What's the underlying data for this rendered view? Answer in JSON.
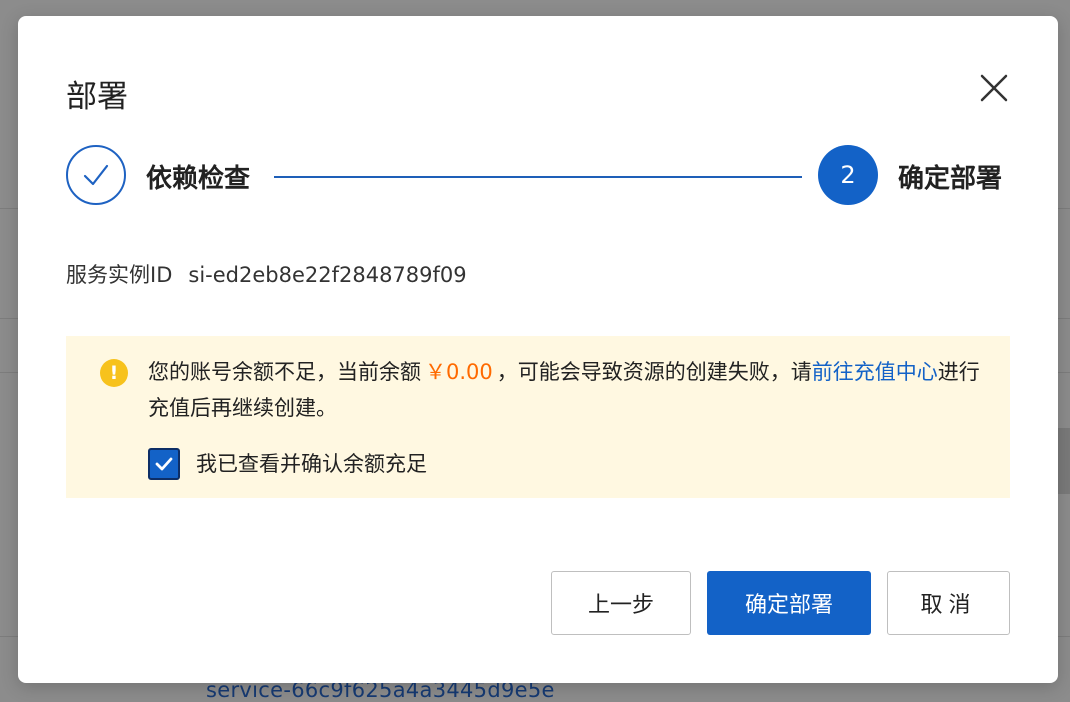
{
  "dialog": {
    "title": "部署",
    "close_icon": "close-icon"
  },
  "steps": [
    {
      "label": "依赖检查",
      "status": "done",
      "icon": "checkmark-icon"
    },
    {
      "label": "确定部署",
      "status": "active",
      "number": "2"
    }
  ],
  "service": {
    "label": "服务实例ID",
    "value": "si-ed2eb8e22f2848789f09"
  },
  "alert": {
    "icon": "warning-icon",
    "text_before": "您的账号余额不足，当前余额",
    "amount": "￥0.00",
    "text_middle": "，可能会导致资源的创建失败，请",
    "link": "前往充值中心",
    "text_after": "进行充值后再继续创建。",
    "checkbox_label": "我已查看并确认余额充足",
    "checkbox_checked": true
  },
  "buttons": {
    "prev": "上一步",
    "confirm": "确定部署",
    "cancel": "取消"
  },
  "background": {
    "link_text": "service-66c9f625a4a3445d9e5e"
  },
  "colors": {
    "primary": "#1362c7",
    "amount": "#ff6a00",
    "alert_bg": "#fff8e1",
    "warning": "#f7c21c"
  }
}
